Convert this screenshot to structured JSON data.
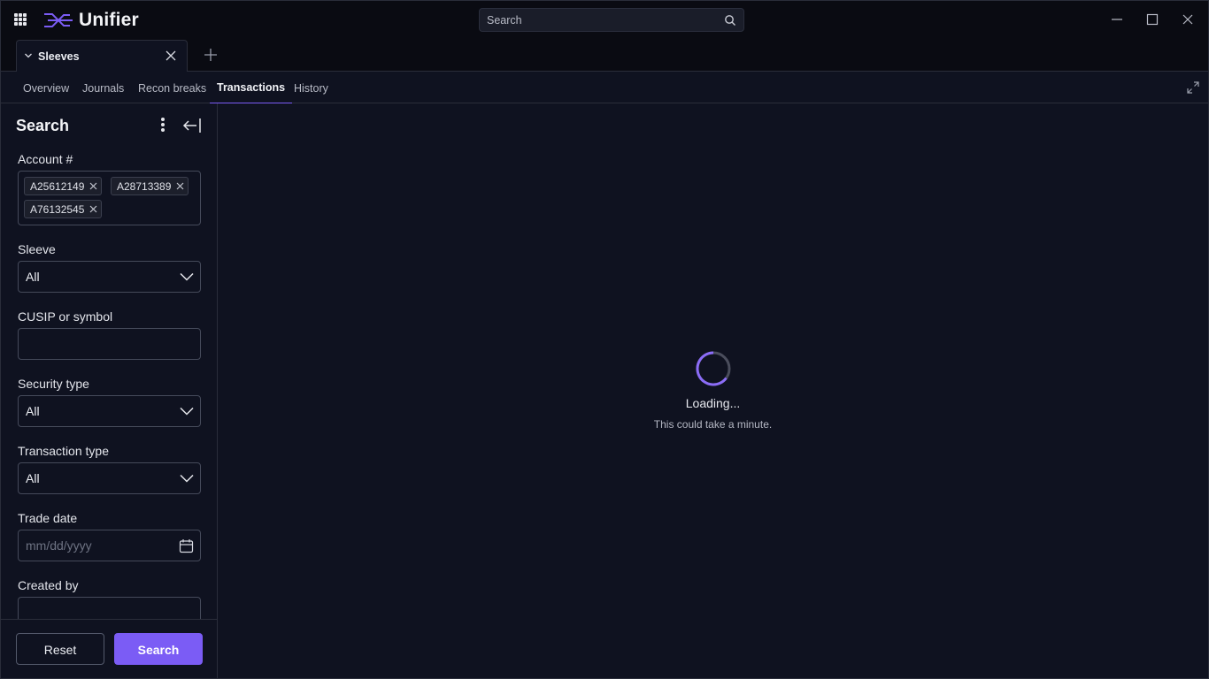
{
  "app": {
    "name": "Unifier",
    "accent_color": "#7b5cf5",
    "icons": [
      "apps-grid-icon",
      "unifier-logo-icon",
      "search-icon",
      "minimize-icon",
      "maximize-icon",
      "close-icon"
    ]
  },
  "header": {
    "search_placeholder": "Search"
  },
  "doc_tab": {
    "label": "Sleeves"
  },
  "subnav": {
    "tabs": [
      {
        "label": "Overview",
        "active": false
      },
      {
        "label": "Journals",
        "active": false
      },
      {
        "label": "Recon breaks",
        "active": false
      },
      {
        "label": "Transactions",
        "active": true
      },
      {
        "label": "History",
        "active": false
      }
    ]
  },
  "sidebar": {
    "title": "Search",
    "account": {
      "label": "Account #",
      "chips": [
        "A25612149",
        "A28713389",
        "A76132545"
      ]
    },
    "sleeve": {
      "label": "Sleeve",
      "value": "All"
    },
    "cusip": {
      "label": "CUSIP or symbol",
      "value": ""
    },
    "security_type": {
      "label": "Security type",
      "value": "All"
    },
    "transaction_type": {
      "label": "Transaction type",
      "value": "All"
    },
    "trade_date": {
      "label": "Trade date",
      "placeholder": "mm/dd/yyyy"
    },
    "created_by": {
      "label": "Created by",
      "value": ""
    },
    "reset_label": "Reset",
    "search_label": "Search"
  },
  "main": {
    "loading_title": "Loading...",
    "loading_subtitle": "This could take a minute."
  }
}
